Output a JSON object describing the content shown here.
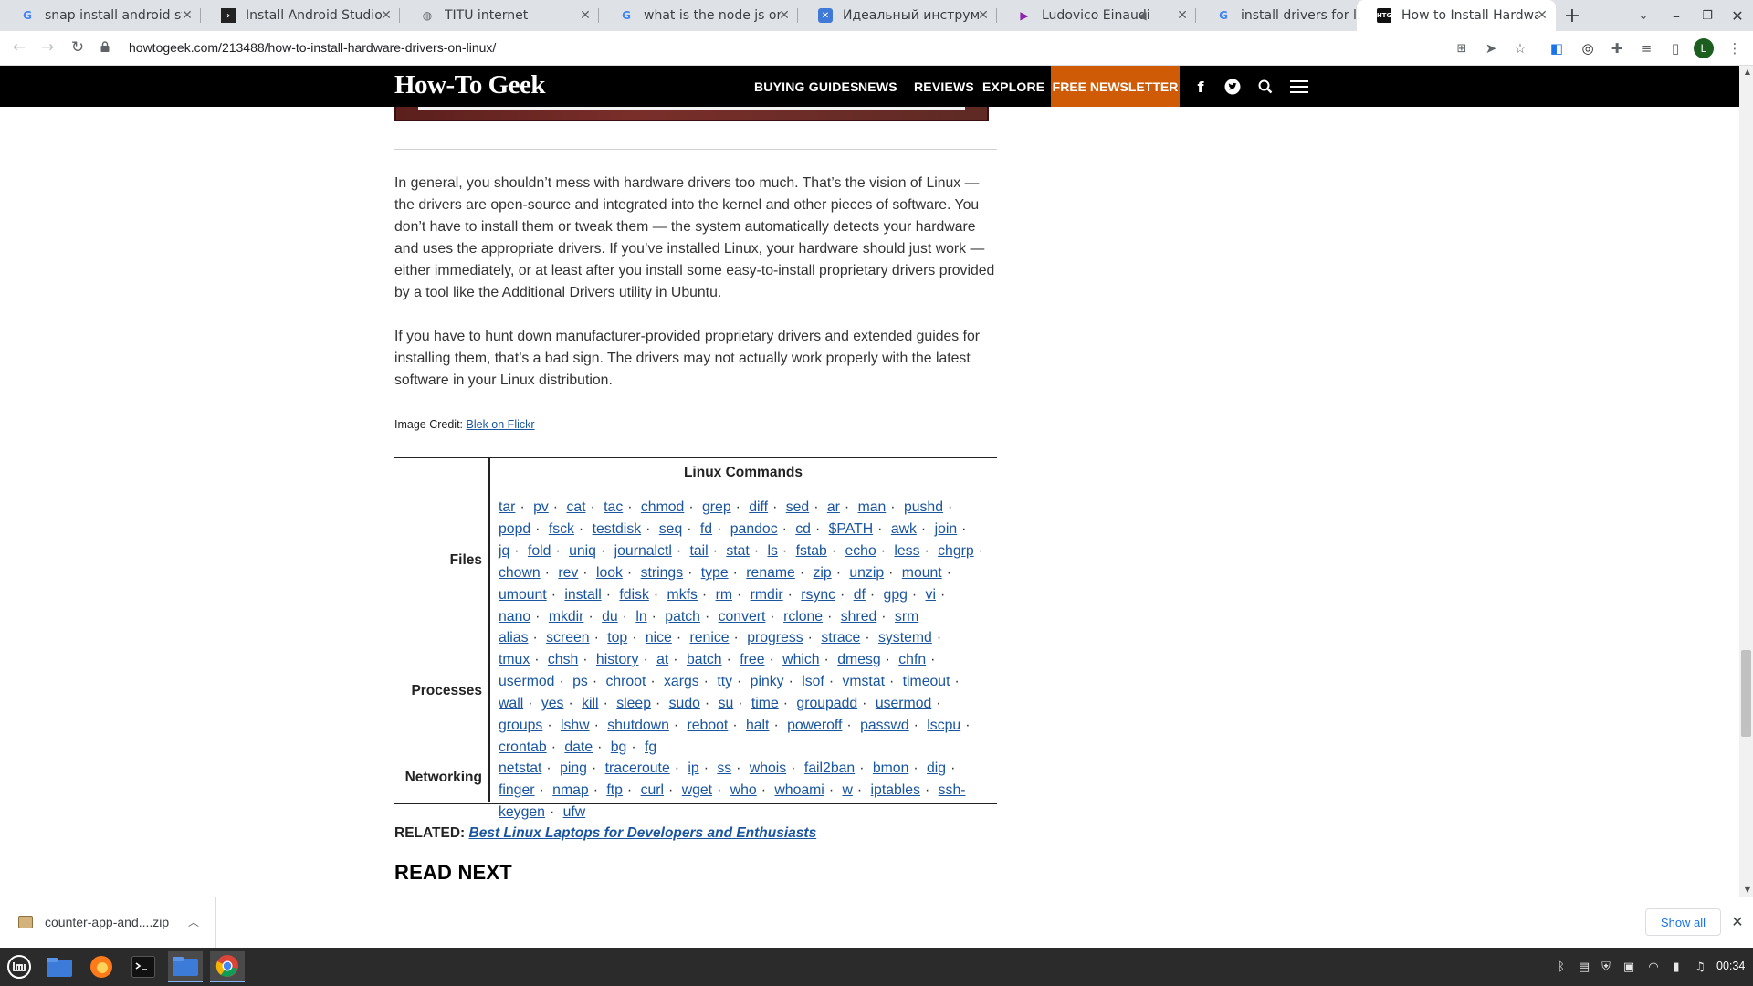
{
  "browser": {
    "tabs": [
      {
        "title": "snap install android stud",
        "favicon": "google-g-icon",
        "active": false
      },
      {
        "title": "Install Android Studio on",
        "favicon": "chevron-logo-icon",
        "active": false
      },
      {
        "title": "TITU internet",
        "favicon": "globe-icon",
        "active": false
      },
      {
        "title": "what is the node js orm -",
        "favicon": "google-g-icon",
        "active": false
      },
      {
        "title": "Идеальный инструмент",
        "favicon": "blue-square-icon",
        "active": false
      },
      {
        "title": "Ludovico Einaudi (Kin",
        "favicon": "purple-play-icon",
        "active": false
      },
      {
        "title": "install drivers for linux m",
        "favicon": "google-g-icon",
        "active": false
      },
      {
        "title": "How to Install Hardware",
        "favicon": "htg-icon",
        "active": true
      }
    ],
    "new_tab_label": "+",
    "url": "howtogeek.com/213488/how-to-install-hardware-drivers-on-linux/",
    "profile_initial": "L"
  },
  "site": {
    "logo": "How-To Geek",
    "nav": [
      "BUYING GUIDES",
      "NEWS",
      "REVIEWS",
      "EXPLORE"
    ],
    "newsletter": "FREE NEWSLETTER"
  },
  "article": {
    "para1": "In general, you shouldn’t mess with hardware drivers too much. That’s the vision of Linux — the drivers are open-source and integrated into the kernel and other pieces of software. You don’t have to install them or tweak them — the system automatically detects your hardware and uses the appropriate drivers. If you’ve installed Linux, your hardware should just work — either immediately, or at least after you install some easy-to-install proprietary drivers provided by a tool like the Additional Drivers utility in Ubuntu.",
    "para2": "If you have to hunt down manufacturer-provided proprietary drivers and extended guides for installing them, that’s a bad sign. The drivers may not actually work properly with the latest software in your Linux distribution.",
    "credit_label": "Image Credit: ",
    "credit_link": "Blek on Flickr",
    "table_title": "Linux Commands",
    "groups": [
      {
        "label": "Files",
        "commands": [
          "tar",
          "pv",
          "cat",
          "tac",
          "chmod",
          "grep",
          "diff",
          "sed",
          "ar",
          "man",
          "pushd",
          "popd",
          "fsck",
          "testdisk",
          "seq",
          "fd",
          "pandoc",
          "cd",
          "$PATH",
          "awk",
          "join",
          "jq",
          "fold",
          "uniq",
          "journalctl",
          "tail",
          "stat",
          "ls",
          "fstab",
          "echo",
          "less",
          "chgrp",
          "chown",
          "rev",
          "look",
          "strings",
          "type",
          "rename",
          "zip",
          "unzip",
          "mount",
          "umount",
          "install",
          "fdisk",
          "mkfs",
          "rm",
          "rmdir",
          "rsync",
          "df",
          "gpg",
          "vi",
          "nano",
          "mkdir",
          "du",
          "ln",
          "patch",
          "convert",
          "rclone",
          "shred",
          "srm"
        ]
      },
      {
        "label": "Processes",
        "commands": [
          "alias",
          "screen",
          "top",
          "nice",
          "renice",
          "progress",
          "strace",
          "systemd",
          "tmux",
          "chsh",
          "history",
          "at",
          "batch",
          "free",
          "which",
          "dmesg",
          "chfn",
          "usermod",
          "ps",
          "chroot",
          "xargs",
          "tty",
          "pinky",
          "lsof",
          "vmstat",
          "timeout",
          "wall",
          "yes",
          "kill",
          "sleep",
          "sudo",
          "su",
          "time",
          "groupadd",
          "usermod",
          "groups",
          "lshw",
          "shutdown",
          "reboot",
          "halt",
          "poweroff",
          "passwd",
          "lscpu",
          "crontab",
          "date",
          "bg",
          "fg"
        ]
      },
      {
        "label": "Networking",
        "commands": [
          "netstat",
          "ping",
          "traceroute",
          "ip",
          "ss",
          "whois",
          "fail2ban",
          "bmon",
          "dig",
          "finger",
          "nmap",
          "ftp",
          "curl",
          "wget",
          "who",
          "whoami",
          "w",
          "iptables",
          "ssh-keygen",
          "ufw"
        ]
      }
    ],
    "related_label": "RELATED: ",
    "related_link": "Best Linux Laptops for Developers and Enthusiasts",
    "read_next": "READ NEXT"
  },
  "downloads": {
    "file_name": "counter-app-and....zip",
    "show_all": "Show all"
  },
  "taskbar": {
    "clock": "00:34",
    "apps": [
      "mint-menu-icon",
      "files-icon",
      "firefox-icon",
      "terminal-icon",
      "files-active-icon",
      "chrome-icon"
    ]
  }
}
